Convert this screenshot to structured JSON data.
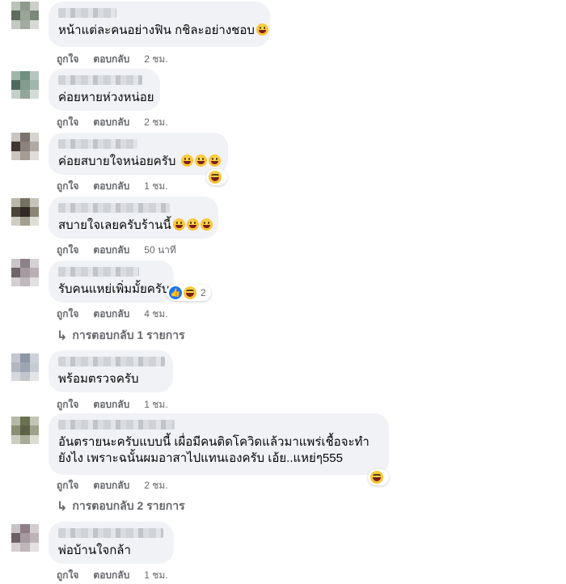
{
  "actions": {
    "like": "ถูกใจ",
    "reply": "ตอบกลับ"
  },
  "colors": {
    "bubble": "#f0f2f5",
    "meta": "#65676b",
    "like": "#1877f2"
  },
  "comments": [
    {
      "text": "หน้าแต่ละคนอย่างฟิน กชิละอย่างชอบ",
      "emojis": 1,
      "time": "2 ชม."
    },
    {
      "text": "ค่อยหายห่วงหน่อย",
      "emojis": 0,
      "time": "2 ชม."
    },
    {
      "text": "ค่อยสบายใจหน่อยครับ",
      "emojis": 3,
      "time": "1 ชม.",
      "reaction": "haha"
    },
    {
      "text": "สบายใจเลยครับร้านนี้",
      "emojis": 3,
      "time": "50 นาที"
    },
    {
      "text": "รับคนแหย่เพิ่มมั้ยครับ",
      "emojis": 0,
      "time": "4 ชม.",
      "reaction_count": "2",
      "replies": "การตอบกลับ 1 รายการ"
    },
    {
      "text": "พร้อมตรวจครับ",
      "emojis": 0,
      "time": "1 ชม."
    },
    {
      "text": "อันตรายนะครับแบบนี้ เผื่อมีคนติดโควิดแล้วมาแพร่เชื้อจะทำยังไง เพราะฉนั้นผมอาสาไปแทนเองครับ เอ้ย..แหย่ๆ555",
      "emojis": 0,
      "time": "2 ชม.",
      "reaction": "haha",
      "replies": "การตอบกลับ 2 รายการ"
    },
    {
      "text": "พ่อบ้านใจกล้า",
      "emojis": 0,
      "time": "1 ชม."
    }
  ]
}
